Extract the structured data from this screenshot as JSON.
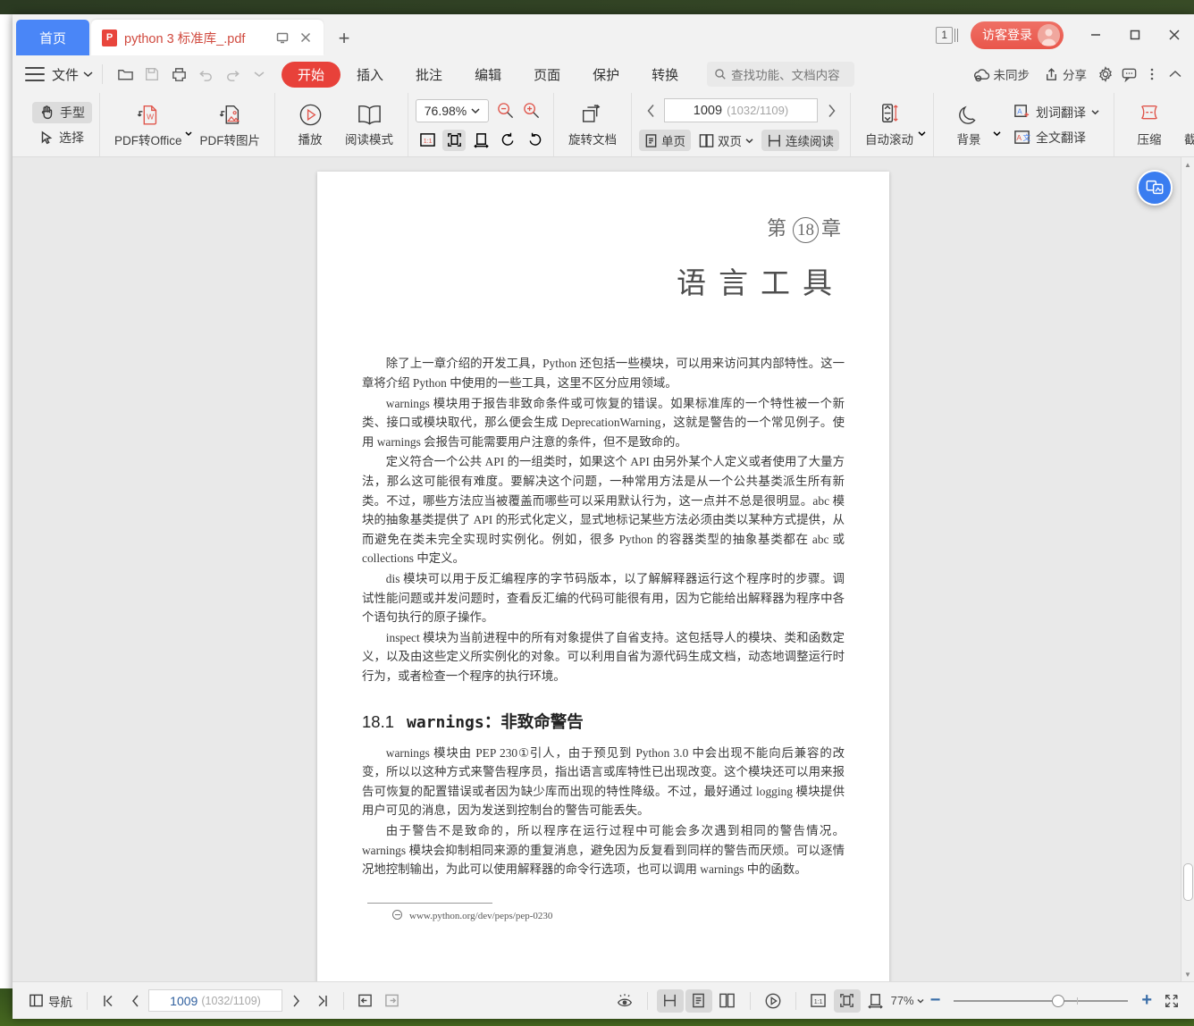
{
  "window": {
    "tabs": [
      {
        "label": "首页",
        "type": "home"
      },
      {
        "label": "python 3 标准库_.pdf",
        "type": "document",
        "badge": "P"
      }
    ],
    "new_tab_label": "+",
    "page_count_badge": "1",
    "login_label": "访客登录",
    "minimize": "—",
    "maximize": "□",
    "close": "✕"
  },
  "ribbon": {
    "file_menu": "文件",
    "quick_icons": [
      "open-folder-icon",
      "save-icon",
      "print-icon",
      "undo-icon",
      "redo-icon",
      "customize-dropdown-icon"
    ],
    "menu_tabs": [
      {
        "label": "开始",
        "active": true
      },
      {
        "label": "插入",
        "active": false
      },
      {
        "label": "批注",
        "active": false
      },
      {
        "label": "编辑",
        "active": false
      },
      {
        "label": "页面",
        "active": false
      },
      {
        "label": "保护",
        "active": false
      },
      {
        "label": "转换",
        "active": false
      }
    ],
    "search_placeholder": "查找功能、文档内容",
    "right_items": [
      {
        "label": "未同步",
        "icon": "cloud-sync-icon"
      },
      {
        "label": "分享",
        "icon": "share-icon"
      }
    ],
    "right_icons": [
      "gear-icon",
      "feedback-icon",
      "more-icon",
      "collapse-ribbon-icon"
    ]
  },
  "toolbar": {
    "hand_tool": "手型",
    "select_tool": "选择",
    "pdf_to_office": "PDF转Office",
    "pdf_to_image": "PDF转图片",
    "play": "播放",
    "read_mode": "阅读模式",
    "zoom_value": "76.98%",
    "zoom_out_icon": "zoom-out-icon",
    "zoom_in_icon": "zoom-in-icon",
    "fit_icons": [
      "actual-size-icon",
      "fit-page-icon",
      "fit-width-icon",
      "rotate-left-icon",
      "rotate-right-icon"
    ],
    "rotate_doc": "旋转文档",
    "page_current": "1009",
    "page_total": "(1032/1109)",
    "prev_page_icon": "chevron-left-icon",
    "next_page_icon": "chevron-right-icon",
    "view_single": "单页",
    "view_double": "双页",
    "view_continuous": "连续阅读",
    "auto_scroll": "自动滚动",
    "background": "背景",
    "word_translate": "划词翻译",
    "full_translate": "全文翻译",
    "compress": "压缩",
    "screenshot_compare": "截图和对比"
  },
  "document": {
    "chapter_label": "第",
    "chapter_number": "18",
    "chapter_suffix": "章",
    "title": "语言工具",
    "paragraphs": [
      "除了上一章介绍的开发工具，Python 还包括一些模块，可以用来访问其内部特性。这一章将介绍 Python 中使用的一些工具，这里不区分应用领域。",
      "warnings 模块用于报告非致命条件或可恢复的错误。如果标准库的一个特性被一个新类、接口或模块取代，那么便会生成 DeprecationWarning，这就是警告的一个常见例子。使用 warnings 会报告可能需要用户注意的条件，但不是致命的。",
      "定义符合一个公共 API 的一组类时，如果这个 API 由另外某个人定义或者使用了大量方法，那么这可能很有难度。要解决这个问题，一种常用方法是从一个公共基类派生所有新类。不过，哪些方法应当被覆盖而哪些可以采用默认行为，这一点并不总是很明显。abc 模块的抽象基类提供了 API 的形式化定义，显式地标记某些方法必须由类以某种方式提供，从而避免在类未完全实现时实例化。例如，很多 Python 的容器类型的抽象基类都在 abc 或 collections 中定义。",
      "dis 模块可以用于反汇编程序的字节码版本，以了解解释器运行这个程序时的步骤。调试性能问题或并发问题时，查看反汇编的代码可能很有用，因为它能给出解释器为程序中各个语句执行的原子操作。",
      "inspect 模块为当前进程中的所有对象提供了自省支持。这包括导人的模块、类和函数定义，以及由这些定义所实例化的对象。可以利用自省为源代码生成文档，动态地调整运行时行为，或者检查一个程序的执行环境。"
    ],
    "section_number": "18.1",
    "section_code": "warnings",
    "section_title": "：非致命警告",
    "section_paragraphs": [
      "warnings 模块由 PEP 230①引人，由于预见到 Python 3.0 中会出现不能向后兼容的改变，所以以这种方式来警告程序员，指出语言或库特性已出现改变。这个模块还可以用来报告可恢复的配置错误或者因为缺少库而出现的特性降级。不过，最好通过 logging 模块提供用户可见的消息，因为发送到控制台的警告可能丢失。",
      "由于警告不是致命的，所以程序在运行过程中可能会多次遇到相同的警告情况。warnings 模块会抑制相同来源的重复消息，避免因为反复看到同样的警告而厌烦。可以逐情况地控制输出，为此可以使用解释器的命令行选项，也可以调用 warnings 中的函数。"
    ],
    "footnote": "www.python.org/dev/peps/pep-0230"
  },
  "statusbar": {
    "navigation": "导航",
    "first_page_icon": "first-page-icon",
    "prev_page_icon": "prev-page-icon",
    "page_current": "1009",
    "page_total": "(1032/1109)",
    "next_page_icon": "next-page-icon",
    "last_page_icon": "last-page-icon",
    "back_icon": "go-back-icon",
    "forward_icon": "go-forward-icon",
    "eye_icon": "eye-protection-icon",
    "split_icon": "split-view-icon",
    "single_page_icon": "single-page-icon",
    "double_page_icon": "double-page-icon",
    "play_icon": "presentation-icon",
    "actual_size_icon": "actual-size-icon",
    "fit_page_icon": "fit-page-icon",
    "fit_width_icon": "fit-width-icon",
    "zoom_percent": "77%",
    "zoom_out": "−",
    "zoom_in": "+",
    "fullscreen_icon": "fullscreen-icon"
  },
  "overlay": {
    "float_button_icon": "translate-compare-icon"
  },
  "colors": {
    "accent_red": "#e8413a",
    "tab_blue": "#4a86f7",
    "login_red": "#ec5d52",
    "float_blue": "#3a7df0"
  }
}
